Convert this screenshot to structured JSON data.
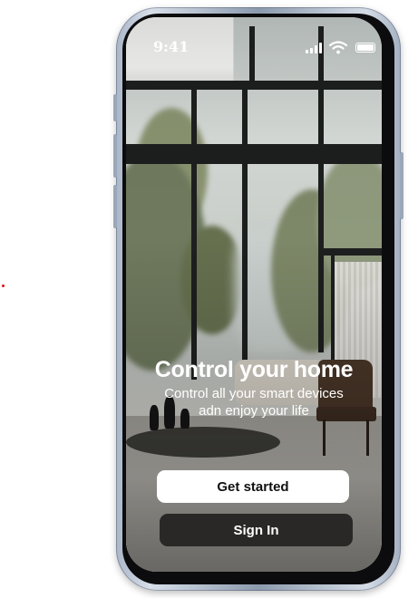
{
  "status_bar": {
    "time": "9:41"
  },
  "onboarding": {
    "title": "Control your home",
    "subtitle_line1": "Control all your smart devices",
    "subtitle_line2": "adn enjoy your life",
    "primary_button": "Get started",
    "secondary_button": "Sign In"
  },
  "colors": {
    "frame": "#aab6c8",
    "primary_button_bg": "#ffffff",
    "secondary_button_bg": "#2a2827",
    "text_on_photo": "#ffffff"
  },
  "icons": [
    "signal-icon",
    "wifi-icon",
    "battery-icon"
  ]
}
